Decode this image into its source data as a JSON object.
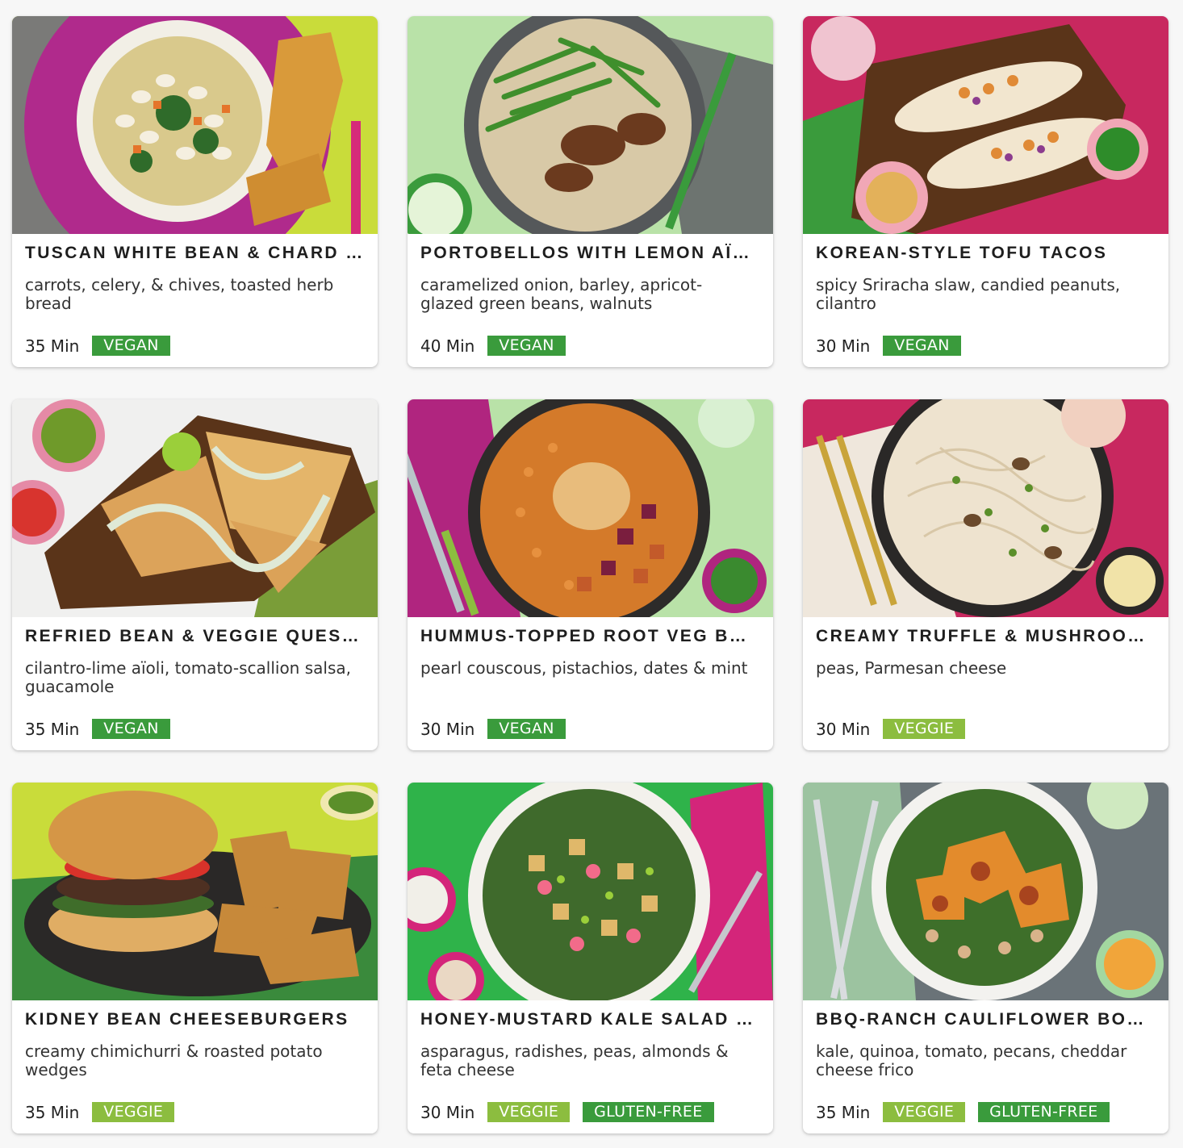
{
  "colors": {
    "vegan": "#3a9b3c",
    "veggie": "#8cbd3f",
    "gluten_free": "#3a9b3c"
  },
  "recipes": [
    {
      "title": "TUSCAN WHITE BEAN & CHARD …",
      "subtitle": "carrots, celery, & chives, toasted herb bread",
      "time": "35 Min",
      "tags": [
        "VEGAN"
      ]
    },
    {
      "title": "PORTOBELLOS WITH LEMON AÏ…",
      "subtitle": "caramelized onion, barley, apricot-glazed green beans, walnuts",
      "time": "40 Min",
      "tags": [
        "VEGAN"
      ]
    },
    {
      "title": "KOREAN-STYLE TOFU TACOS",
      "subtitle": "spicy Sriracha slaw, candied peanuts, cilantro",
      "time": "30 Min",
      "tags": [
        "VEGAN"
      ]
    },
    {
      "title": "REFRIED BEAN & VEGGIE QUES…",
      "subtitle": "cilantro-lime aïoli, tomato-scallion salsa, guacamole",
      "time": "35 Min",
      "tags": [
        "VEGAN"
      ]
    },
    {
      "title": "HUMMUS-TOPPED ROOT VEG B…",
      "subtitle": "pearl couscous, pistachios, dates & mint",
      "time": "30 Min",
      "tags": [
        "VEGAN"
      ]
    },
    {
      "title": "CREAMY TRUFFLE & MUSHROO…",
      "subtitle": "peas, Parmesan cheese",
      "time": "30 Min",
      "tags": [
        "VEGGIE"
      ]
    },
    {
      "title": "KIDNEY BEAN CHEESEBURGERS",
      "subtitle": "creamy chimichurri & roasted potato wedges",
      "time": "35 Min",
      "tags": [
        "VEGGIE"
      ]
    },
    {
      "title": "HONEY-MUSTARD KALE SALAD …",
      "subtitle": "asparagus, radishes, peas, almonds & feta cheese",
      "time": "30 Min",
      "tags": [
        "VEGGIE",
        "GLUTEN-FREE"
      ]
    },
    {
      "title": "BBQ-RANCH CAULIFLOWER BO…",
      "subtitle": "kale, quinoa, tomato, pecans, cheddar cheese frico",
      "time": "35 Min",
      "tags": [
        "VEGGIE",
        "GLUTEN-FREE"
      ]
    }
  ]
}
